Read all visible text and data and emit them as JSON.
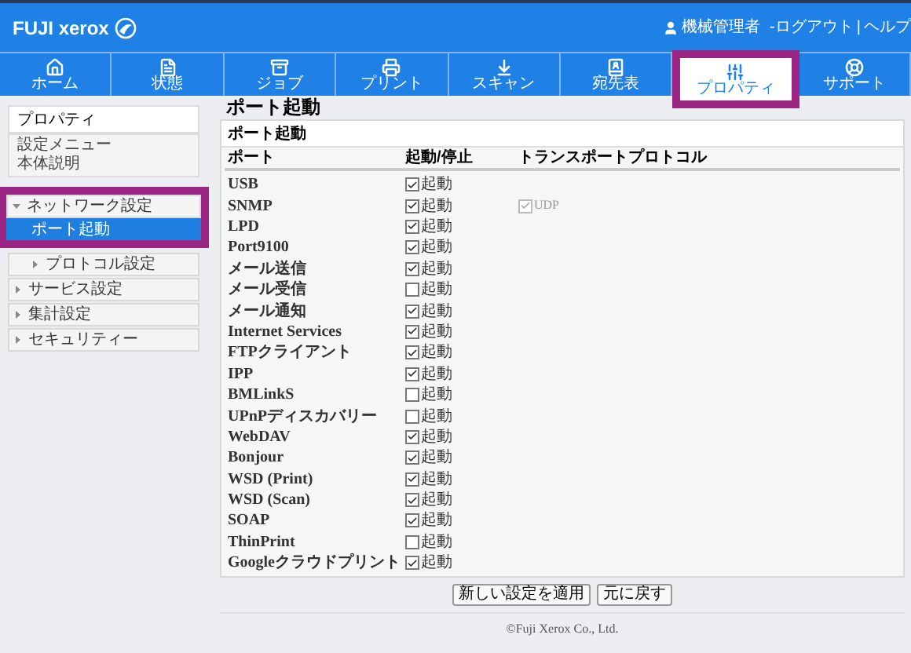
{
  "header": {
    "brand": "FUJI xerox",
    "user": "機械管理者",
    "logout": "-ログアウト",
    "separator": "|",
    "help": "ヘルプ"
  },
  "nav": [
    {
      "label": "ホーム",
      "kind": "home",
      "selected": false
    },
    {
      "label": "状態",
      "kind": "status",
      "selected": false
    },
    {
      "label": "ジョブ",
      "kind": "jobs",
      "selected": false
    },
    {
      "label": "プリント",
      "kind": "print",
      "selected": false
    },
    {
      "label": "スキャン",
      "kind": "scan",
      "selected": false
    },
    {
      "label": "宛先表",
      "kind": "contacts",
      "selected": false
    },
    {
      "label": "プロパティ",
      "kind": "properties",
      "selected": true
    },
    {
      "label": "サポート",
      "kind": "support",
      "selected": false
    }
  ],
  "sidebar": {
    "heading": "プロパティ",
    "links": [
      "設定メニュー",
      "本体説明"
    ],
    "tree": [
      {
        "label": "ネットワーク設定",
        "expanded": true,
        "highlighted": true,
        "indented": false,
        "children": [
          {
            "label": "ポート起動",
            "selected": true
          }
        ]
      },
      {
        "label": "プロトコル設定",
        "expanded": false,
        "highlighted": false,
        "indented": true
      },
      {
        "label": "サービス設定",
        "expanded": false,
        "highlighted": false,
        "indented": false
      },
      {
        "label": "集計設定",
        "expanded": false,
        "highlighted": false,
        "indented": false
      },
      {
        "label": "セキュリティー",
        "expanded": false,
        "highlighted": false,
        "indented": false
      }
    ]
  },
  "page_title": "ポート起動",
  "panel": {
    "title": "ポート起動",
    "columns": [
      "ポート",
      "起動/停止",
      "トランスポートプロトコル"
    ],
    "rows": [
      {
        "port": "USB",
        "label": "起動",
        "checked": true
      },
      {
        "port": "SNMP",
        "label": "起動",
        "checked": true,
        "transport": {
          "label": "UDP",
          "checked": true,
          "disabled": true
        }
      },
      {
        "port": "LPD",
        "label": "起動",
        "checked": true
      },
      {
        "port": "Port9100",
        "label": "起動",
        "checked": true
      },
      {
        "port": "メール送信",
        "label": "起動",
        "checked": true
      },
      {
        "port": "メール受信",
        "label": "起動",
        "checked": false
      },
      {
        "port": "メール通知",
        "label": "起動",
        "checked": true
      },
      {
        "port": "Internet Services",
        "label": "起動",
        "checked": true
      },
      {
        "port": "FTPクライアント",
        "label": "起動",
        "checked": true
      },
      {
        "port": "IPP",
        "label": "起動",
        "checked": true
      },
      {
        "port": "BMLinkS",
        "label": "起動",
        "checked": false
      },
      {
        "port": "UPnPディスカバリー",
        "label": "起動",
        "checked": false
      },
      {
        "port": "WebDAV",
        "label": "起動",
        "checked": true
      },
      {
        "port": "Bonjour",
        "label": "起動",
        "checked": true
      },
      {
        "port": "WSD (Print)",
        "label": "起動",
        "checked": true
      },
      {
        "port": "WSD (Scan)",
        "label": "起動",
        "checked": true
      },
      {
        "port": "SOAP",
        "label": "起動",
        "checked": true
      },
      {
        "port": "ThinPrint",
        "label": "起動",
        "checked": false
      },
      {
        "port": "Googleクラウドプリント",
        "label": "起動",
        "checked": true
      }
    ]
  },
  "buttons": [
    "新しい設定を適用",
    "元に戻す"
  ],
  "footer": "©Fuji Xerox Co., Ltd."
}
